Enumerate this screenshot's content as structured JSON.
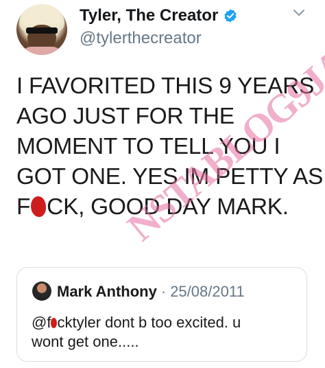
{
  "author": {
    "name": "Tyler, The Creator",
    "handle": "@tylerthecreator",
    "verified": true
  },
  "icons": {
    "verified": "verified-badge-icon",
    "menu": "chevron-down-icon"
  },
  "tweet": {
    "lines": [
      "I FAVORITED THIS 9 YEARS",
      "AGO JUST FOR THE",
      "MOMENT TO TELL YOU I",
      "GOT ONE. YES IM PETTY AS"
    ],
    "last_prefix": "F",
    "last_suffix": "CK, GOOD DAY MARK."
  },
  "watermark": "NSTABLOG9JA",
  "quoted": {
    "name": "Mark Anthony",
    "separator": "·",
    "date": "25/08/2011",
    "text_prefix": "@f",
    "text_suffix": "cktyler dont b too excited. u",
    "text_line2": "wont get one....."
  },
  "colors": {
    "verified": "#1da1f2",
    "muted": "#657786",
    "censor": "#cf1d1d",
    "watermark": "#e66ea0"
  }
}
